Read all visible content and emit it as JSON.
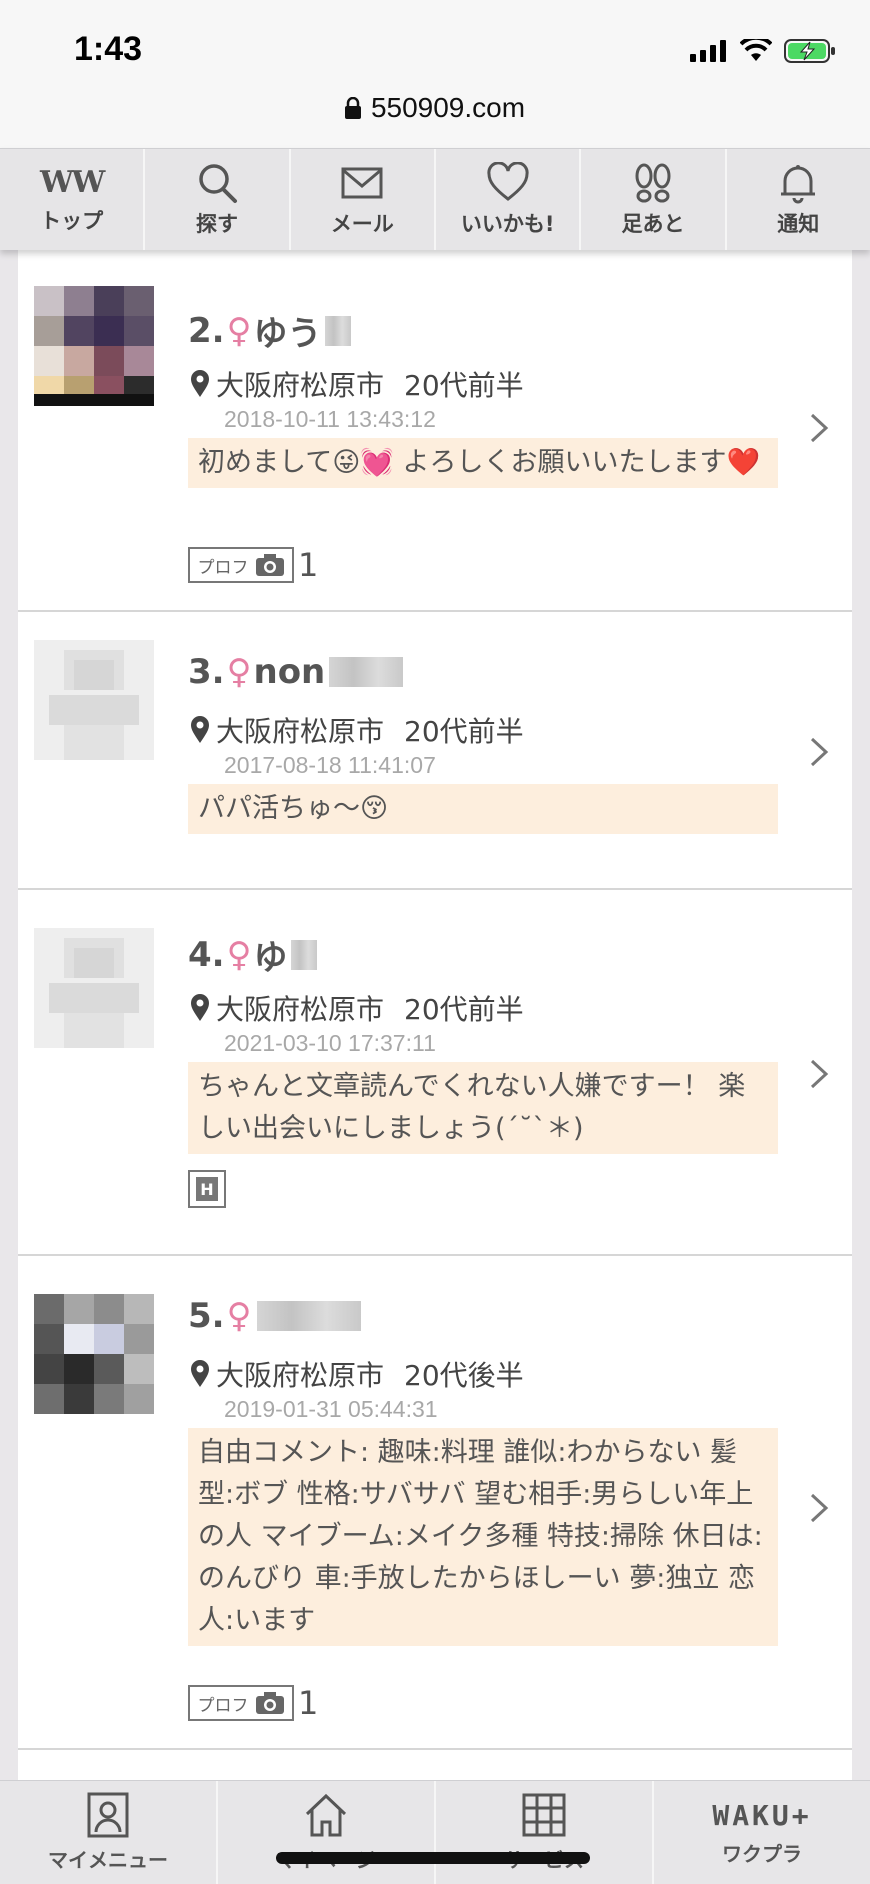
{
  "status_bar": {
    "time": "1:43"
  },
  "browser": {
    "url": "550909.com"
  },
  "top_nav": [
    {
      "label": "トップ",
      "icon": "logo-ww-icon"
    },
    {
      "label": "探す",
      "icon": "search-icon"
    },
    {
      "label": "メール",
      "icon": "mail-icon"
    },
    {
      "label": "いいかも!",
      "icon": "heart-icon"
    },
    {
      "label": "足あと",
      "icon": "footprint-icon"
    },
    {
      "label": "通知",
      "icon": "bell-icon"
    }
  ],
  "logo_text": "WW",
  "female_symbol": "♀",
  "profiles": [
    {
      "rank": "2.",
      "name": "ゆう",
      "location": "大阪府松原市",
      "age": "20代前半",
      "date": "2018-10-11 13:43:12",
      "message": "初めまして😜💓 よろしくお願いいたします❤️",
      "prof_label": "プロフ",
      "photo_count": "1"
    },
    {
      "rank": "3.",
      "name": "non",
      "location": "大阪府松原市",
      "age": "20代前半",
      "date": "2017-08-18 11:41:07",
      "message": "パパ活ちゅ〜😚"
    },
    {
      "rank": "4.",
      "name": "ゆ",
      "location": "大阪府松原市",
      "age": "20代前半",
      "date": "2021-03-10 17:37:11",
      "message": "ちゃんと文章読んでくれない人嫌ですー！ 楽しい出会いにしましょう(´˘`＊)",
      "badge": "H"
    },
    {
      "rank": "5.",
      "name": "",
      "location": "大阪府松原市",
      "age": "20代後半",
      "date": "2019-01-31 05:44:31",
      "message": "自由コメント: 趣味:料理 誰似:わからない 髪型:ボブ 性格:サバサバ 望む相手:男らしい年上の人 マイブーム:メイク多種 特技:掃除 休日は:のんびり 車:手放したからほしーい 夢:独立 恋人:います",
      "prof_label": "プロフ",
      "photo_count": "1"
    }
  ],
  "bottom_nav": [
    {
      "label": "マイメニュー",
      "icon": "user-card-icon"
    },
    {
      "label": "マイページ",
      "icon": "home-icon"
    },
    {
      "label": "サービス",
      "icon": "grid-icon"
    },
    {
      "label": "ワクプラ",
      "icon": "waku-plus-logo"
    }
  ],
  "waku_logo": "WAKU+",
  "colors": {
    "accent_pink": "#e57fa3",
    "message_bg": "#fdeedd",
    "nav_bg": "#e6e5e7"
  }
}
